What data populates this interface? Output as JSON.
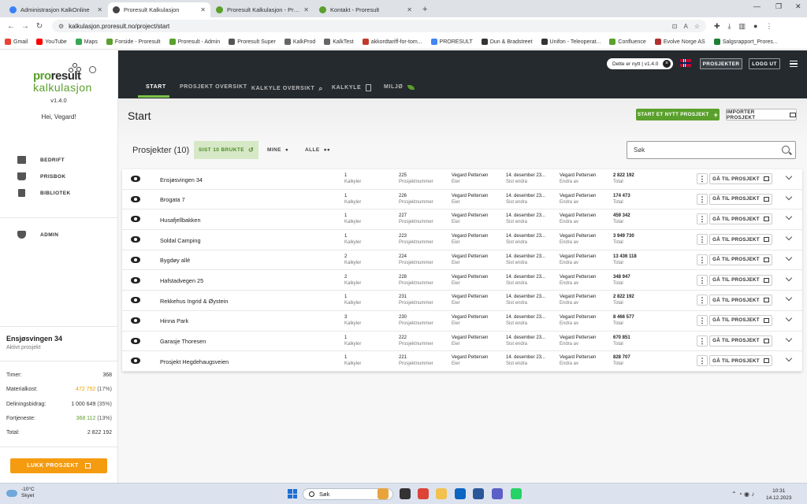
{
  "browser": {
    "tabs": [
      {
        "title": "Administrasjon KalkOnline",
        "active": false,
        "icon_color": "#3b82f6"
      },
      {
        "title": "Proresult Kalkulasjon",
        "active": true,
        "icon_color": "#444444"
      },
      {
        "title": "Proresult Kalkulasjon - Prosjekt",
        "active": false,
        "icon_color": "#5aa02c"
      },
      {
        "title": "Kontakt - Proresult",
        "active": false,
        "icon_color": "#5aa02c"
      }
    ],
    "new_tab": "+",
    "url": "kalkulasjon.proresult.no/project/start",
    "bookmarks": [
      {
        "label": "Gmail",
        "color": "#ea4335"
      },
      {
        "label": "YouTube",
        "color": "#ff0000"
      },
      {
        "label": "Maps",
        "color": "#34a853"
      },
      {
        "label": "Forside - Proresult",
        "color": "#5aa02c"
      },
      {
        "label": "Proresult - Admin",
        "color": "#5aa02c"
      },
      {
        "label": "Proresult Super",
        "color": "#555555"
      },
      {
        "label": "KalkProd",
        "color": "#666666"
      },
      {
        "label": "KalkTest",
        "color": "#666666"
      },
      {
        "label": "akkordtariff-for-tom...",
        "color": "#c0392b"
      },
      {
        "label": "PRORESULT",
        "color": "#4285f4"
      },
      {
        "label": "Dun & Bradstreet",
        "color": "#333333"
      },
      {
        "label": "Unifon - Teleoperat...",
        "color": "#333333"
      },
      {
        "label": "Confluence",
        "color": "#5aa02c"
      },
      {
        "label": "Evolve Norge AS",
        "color": "#b03030"
      },
      {
        "label": "Salgsrapport_Prores...",
        "color": "#1e7e34"
      }
    ]
  },
  "sidebar": {
    "logo_pro": "pro",
    "logo_result": "result",
    "logo_sub": "kalkulasjon",
    "version": "v1.4.0",
    "greeting": "Hei, Vegard!",
    "nav": [
      {
        "label": "BEDRIFT",
        "icon": "building-icon"
      },
      {
        "label": "PRISBOK",
        "icon": "box-icon"
      },
      {
        "label": "BIBLIOTEK",
        "icon": "library-icon"
      }
    ],
    "admin": {
      "label": "ADMIN",
      "icon": "shield-icon"
    },
    "active_project": {
      "name": "Ensjøsvingen 34",
      "subtitle": "Aktivt prosjekt"
    },
    "stats": [
      {
        "label": "Timer:",
        "value": "368",
        "pct": "",
        "style": ""
      },
      {
        "label": "Materialkost:",
        "value": "472 752",
        "pct": "(17%)",
        "style": "hl"
      },
      {
        "label": "Deliningsbidrag:",
        "value": "1 000 649",
        "pct": "(35%)",
        "style": ""
      },
      {
        "label": "Fortjeneste:",
        "value": "368 112",
        "pct": "(13%)",
        "style": "gn"
      },
      {
        "label": "Total:",
        "value": "2 822 192",
        "pct": "",
        "style": ""
      }
    ],
    "close_button": "LUKK PROSJEKT"
  },
  "header": {
    "news_label": "Dette er nytt | v1.4.0",
    "projects_button": "PROSJEKTER",
    "logout_button": "LOGG UT",
    "tabs": [
      {
        "label": "START",
        "active": true
      },
      {
        "label": "PROSJEKT OVERSIKT",
        "active": false
      },
      {
        "label": "KALKYLE OVERSIKT",
        "active": false
      },
      {
        "label": "KALKYLE",
        "active": false
      },
      {
        "label": "MILJØ",
        "active": false
      }
    ]
  },
  "main": {
    "title": "Start",
    "new_project_button": "START ET NYTT PROSJEKT",
    "import_button": "IMPORTER PROSJEKT",
    "list_title": "Prosjekter (10)",
    "filters": {
      "recent": "SIST 10 BRUKTE",
      "mine": "MINE",
      "all": "ALLE"
    },
    "search_placeholder": "Søk",
    "labels": {
      "calcs": "Kalkyler",
      "number": "Prosjektnummer",
      "owner": "Eier",
      "last_opened": "Sist endra",
      "changed_by": "Endra av",
      "total": "Total",
      "go": "GÅ TIL PROSJEKT"
    },
    "projects": [
      {
        "name": "Ensjøsvingen 34",
        "calcs": "1",
        "number": "225",
        "owner": "Vegard Pettersen",
        "date": "14. desember 23...",
        "changed_by": "Vegard Pettersen",
        "total": "2 822 192"
      },
      {
        "name": "Brogata 7",
        "calcs": "1",
        "number": "226",
        "owner": "Vegard Pettersen",
        "date": "14. desember 23...",
        "changed_by": "Vegard Pettersen",
        "total": "174 473"
      },
      {
        "name": "Husafjellbakken",
        "calcs": "1",
        "number": "227",
        "owner": "Vegard Pettersen",
        "date": "14. desember 23...",
        "changed_by": "Vegard Pettersen",
        "total": "459 342"
      },
      {
        "name": "Soldal Camping",
        "calcs": "1",
        "number": "223",
        "owner": "Vegard Pettersen",
        "date": "14. desember 23...",
        "changed_by": "Vegard Pettersen",
        "total": "3 949 730"
      },
      {
        "name": "Bygdøy allé",
        "calcs": "2",
        "number": "224",
        "owner": "Vegard Pettersen",
        "date": "14. desember 23...",
        "changed_by": "Vegard Pettersen",
        "total": "13 436 118"
      },
      {
        "name": "Hafstadvegen 25",
        "calcs": "2",
        "number": "228",
        "owner": "Vegard Pettersen",
        "date": "14. desember 23...",
        "changed_by": "Vegard Pettersen",
        "total": "348 947"
      },
      {
        "name": "Rekkehus Ingrid & Øystein",
        "calcs": "1",
        "number": "231",
        "owner": "Vegard Pettersen",
        "date": "14. desember 23...",
        "changed_by": "Vegard Pettersen",
        "total": "2 822 192"
      },
      {
        "name": "Hinna Park",
        "calcs": "3",
        "number": "230",
        "owner": "Vegard Pettersen",
        "date": "14. desember 23...",
        "changed_by": "Vegard Pettersen",
        "total": "8 466 577"
      },
      {
        "name": "Garasje Thoresen",
        "calcs": "1",
        "number": "222",
        "owner": "Vegard Pettersen",
        "date": "14. desember 23...",
        "changed_by": "Vegard Pettersen",
        "total": "670 851"
      },
      {
        "name": "Prosjekt Hegdehaugsveien",
        "calcs": "1",
        "number": "221",
        "owner": "Vegard Pettersen",
        "date": "14. desember 23...",
        "changed_by": "Vegard Pettersen",
        "total": "828 707"
      }
    ]
  },
  "taskbar": {
    "temperature": "-10°C",
    "weather": "Skyet",
    "search": "Søk",
    "time": "10:31",
    "date": "14.12.2023",
    "apps": [
      "#e8a33d",
      "#333333",
      "#db4437",
      "#f2c14e",
      "#0a66c2",
      "#2b579a",
      "#5b5fc7",
      "#25d366"
    ]
  },
  "colors": {
    "accent": "#5aa02c",
    "orange": "#f59b10",
    "header": "#252a2e"
  }
}
